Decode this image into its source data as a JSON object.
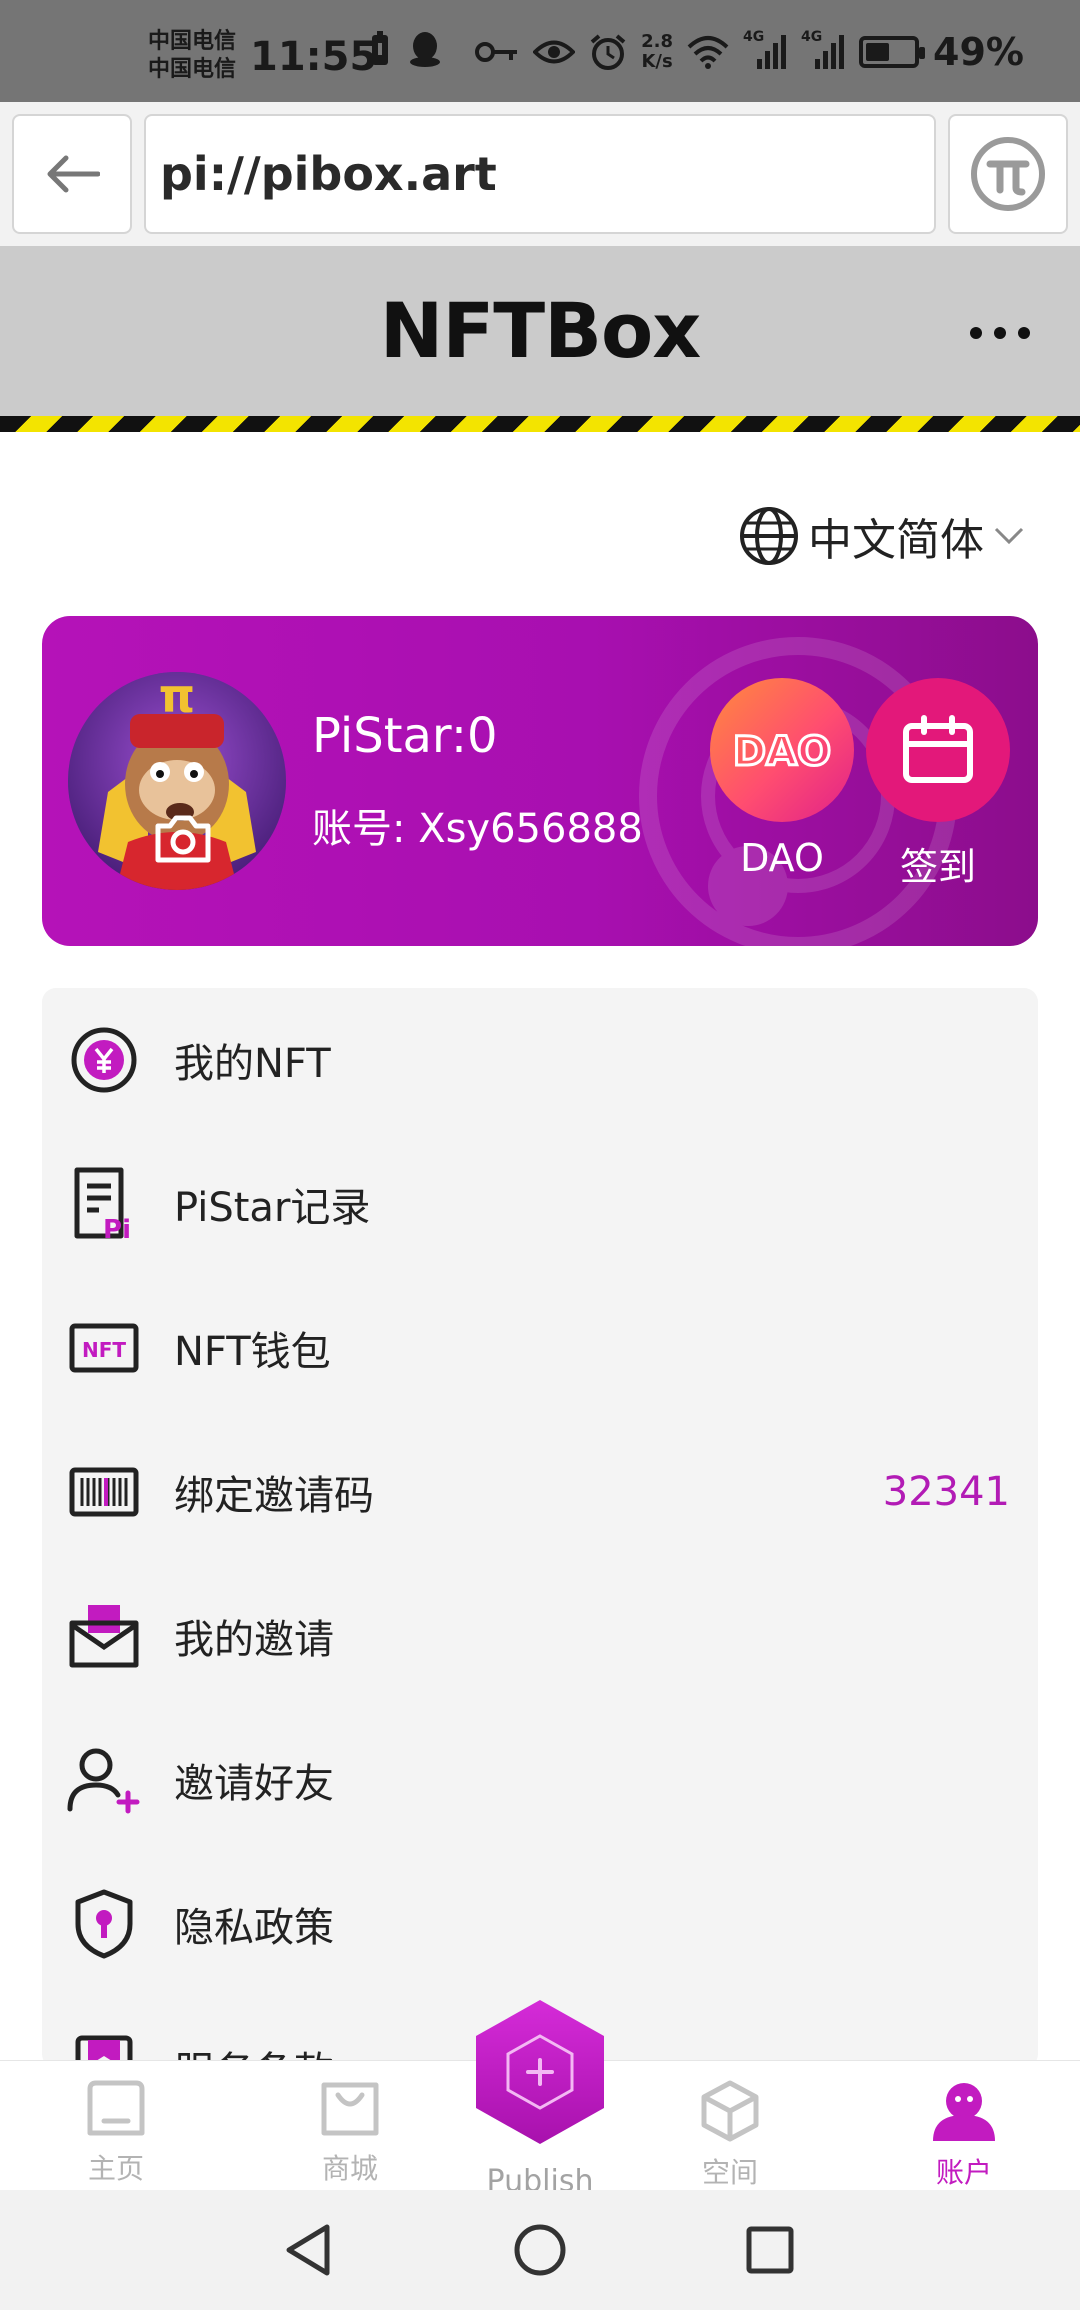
{
  "status_bar": {
    "carrier_1": "中国电信",
    "carrier_2": "中国电信",
    "time": "11:55",
    "net_speed_value": "2.8",
    "net_speed_unit": "K/s",
    "signal_1_tag": "4G",
    "signal_2_tag": "4G",
    "battery": "49%",
    "battery_level": 0.49
  },
  "browser": {
    "url": "pi://pibox.art"
  },
  "header": {
    "title": "NFTBox"
  },
  "language": {
    "label": "中文简体"
  },
  "profile": {
    "pistar": "PiStar:0",
    "account": "账号: Xsy656888",
    "dao_icon_text": "DAO",
    "dao_label": "DAO",
    "sign_label": "签到"
  },
  "menu": {
    "items": [
      {
        "label": "我的NFT",
        "icon": "yen-coin-icon"
      },
      {
        "label": "PiStar记录",
        "icon": "record-document-icon",
        "icon_text": "Pi"
      },
      {
        "label": "NFT钱包",
        "icon": "nft-wallet-icon",
        "icon_text": "NFT"
      },
      {
        "label": "绑定邀请码",
        "icon": "barcode-icon",
        "value": "32341"
      },
      {
        "label": "我的邀请",
        "icon": "invitation-envelope-icon"
      },
      {
        "label": "邀请好友",
        "icon": "add-friend-icon"
      },
      {
        "label": "隐私政策",
        "icon": "privacy-shield-icon"
      },
      {
        "label": "服务条款",
        "icon": "terms-icon"
      }
    ]
  },
  "bottom_nav": {
    "home": "主页",
    "store": "商城",
    "publish": "Publish",
    "space": "空间",
    "account": "账户"
  },
  "colors": {
    "accent": "#b21bb5",
    "card_start": "#b512b8",
    "card_end": "#8c0d8c",
    "hazard_yellow": "#f3e400"
  }
}
